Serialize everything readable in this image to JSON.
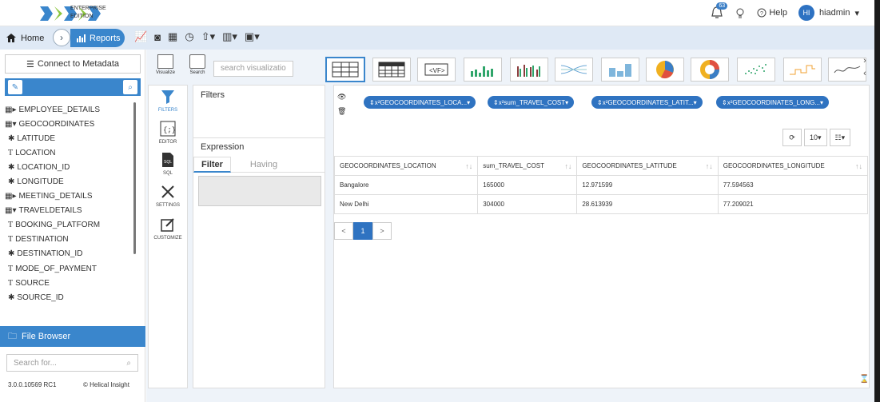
{
  "header": {
    "edition_line1": "ENTERPRISE",
    "edition_line2": "EDITION",
    "notification_count": "63",
    "help_label": "Help",
    "avatar_initials": "HI",
    "username": "hiadmin"
  },
  "nav": {
    "home_label": "Home",
    "reports_label": "Reports"
  },
  "sidebar": {
    "connect_label": "Connect to Metadata",
    "tree": [
      {
        "label": "EMPLOYEE_DETAILS",
        "kind": "table",
        "expanded": false
      },
      {
        "label": "GEOCOORDINATES",
        "kind": "table",
        "expanded": true
      },
      {
        "label": "LATITUDE",
        "kind": "measure"
      },
      {
        "label": "LOCATION",
        "kind": "text"
      },
      {
        "label": "LOCATION_ID",
        "kind": "measure"
      },
      {
        "label": "LONGITUDE",
        "kind": "measure"
      },
      {
        "label": "MEETING_DETAILS",
        "kind": "table",
        "expanded": false
      },
      {
        "label": "TRAVELDETAILS",
        "kind": "table",
        "expanded": true
      },
      {
        "label": "BOOKING_PLATFORM",
        "kind": "text"
      },
      {
        "label": "DESTINATION",
        "kind": "text"
      },
      {
        "label": "DESTINATION_ID",
        "kind": "measure"
      },
      {
        "label": "MODE_OF_PAYMENT",
        "kind": "text"
      },
      {
        "label": "SOURCE",
        "kind": "text"
      },
      {
        "label": "SOURCE_ID",
        "kind": "measure"
      }
    ],
    "file_browser_label": "File Browser",
    "search_placeholder": "Search for...",
    "version": "3.0.0.10569 RC1",
    "copyright": "© Helical Insight"
  },
  "viz_panel": {
    "visualize_label": "Visualize",
    "search_label": "Search",
    "search_placeholder": "search visualizatio"
  },
  "side_tools": {
    "filters": "FILTERS",
    "editor": "EDITOR",
    "sql": "SQL",
    "settings": "SETTINGS",
    "customize": "CUSTOMIZE"
  },
  "filters_panel": {
    "filters_title": "Filters",
    "expression_title": "Expression",
    "tab_filter": "Filter",
    "tab_having": "Having"
  },
  "pills": [
    "GEOCOORDINATES_LOCA...",
    "sum_TRAVEL_COST",
    "GEOCOORDINATES_LATIT...",
    "GEOCOORDINATES_LONG..."
  ],
  "table": {
    "page_size": "10",
    "columns": [
      "GEOCOORDINATES_LOCATION",
      "sum_TRAVEL_COST",
      "GEOCOORDINATES_LATITUDE",
      "GEOCOORDINATES_LONGITUDE"
    ],
    "rows": [
      [
        "Bangalore",
        "165000",
        "12.971599",
        "77.594563"
      ],
      [
        "New Delhi",
        "304000",
        "28.613939",
        "77.209021"
      ]
    ]
  },
  "pager": {
    "prev": "<",
    "current": "1",
    "next": ">"
  },
  "colors": {
    "accent": "#3a86cc",
    "pill": "#2f73c1"
  }
}
